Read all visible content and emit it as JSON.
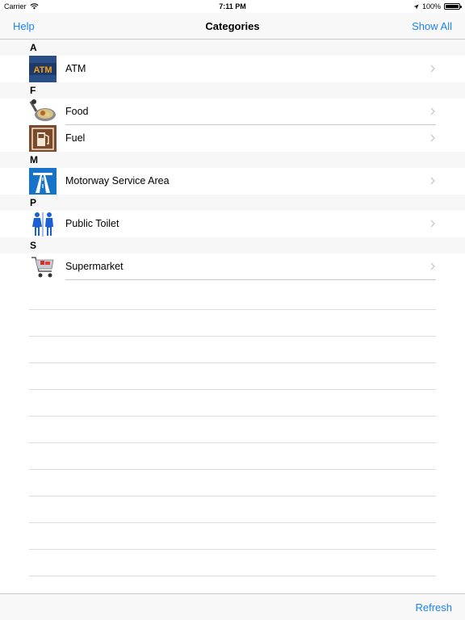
{
  "status": {
    "carrier": "Carrier",
    "time": "7:11 PM",
    "battery": "100%"
  },
  "nav": {
    "left": "Help",
    "title": "Categories",
    "right": "Show All"
  },
  "sections": [
    {
      "letter": "A",
      "items": [
        {
          "label": "ATM",
          "icon": "atm-icon"
        }
      ]
    },
    {
      "letter": "F",
      "items": [
        {
          "label": "Food",
          "icon": "food-icon"
        },
        {
          "label": "Fuel",
          "icon": "fuel-pump-icon"
        }
      ]
    },
    {
      "letter": "M",
      "items": [
        {
          "label": "Motorway Service Area",
          "icon": "motorway-icon"
        }
      ]
    },
    {
      "letter": "P",
      "items": [
        {
          "label": "Public Toilet",
          "icon": "toilet-icon"
        }
      ]
    },
    {
      "letter": "S",
      "items": [
        {
          "label": "Supermarket",
          "icon": "shopping-cart-icon"
        }
      ]
    }
  ],
  "toolbar": {
    "refresh": "Refresh"
  },
  "colors": {
    "accent": "#1a82f7",
    "separator": "#c8c7cc",
    "section_bg": "#f7f7f7"
  }
}
